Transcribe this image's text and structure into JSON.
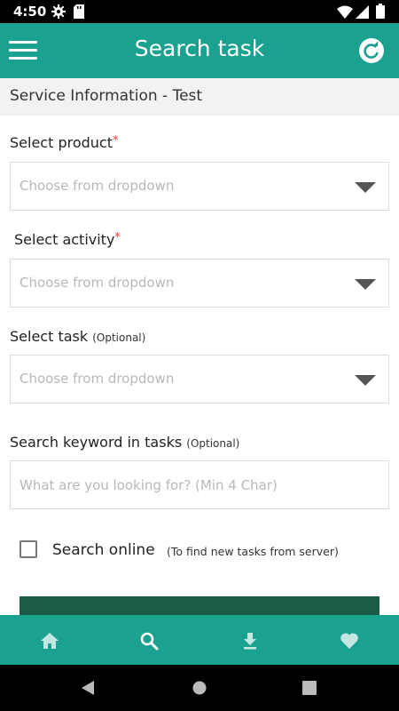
{
  "status_bar": {
    "time": "4:50",
    "icons": [
      "settings-icon",
      "sd-card-icon",
      "wifi-icon",
      "signal-icon",
      "battery-icon"
    ]
  },
  "app_bar": {
    "title": "Search task",
    "menu_icon": "hamburger-menu-icon",
    "refresh_icon": "refresh-icon",
    "color": "#1aa190"
  },
  "section_header": {
    "text": "Service Information - Test"
  },
  "form": {
    "product": {
      "label": "Select product",
      "required_mark": "*",
      "placeholder": "Choose from dropdown"
    },
    "activity": {
      "label": "Select activity",
      "required_mark": "*",
      "placeholder": "Choose from dropdown"
    },
    "task": {
      "label": "Select task",
      "optional_note": "(Optional)",
      "placeholder": "Choose from dropdown"
    },
    "keyword": {
      "label": "Search keyword in tasks",
      "optional_note": "(Optional)",
      "placeholder": "What are you looking for? (Min 4 Char)",
      "value": ""
    },
    "search_online": {
      "label": "Search online",
      "hint": "(To find new tasks from server)",
      "checked": false
    },
    "submit_button_color": "#1a5c47"
  },
  "bottom_nav": {
    "items": [
      {
        "name": "home",
        "icon": "home-icon"
      },
      {
        "name": "search",
        "icon": "search-icon"
      },
      {
        "name": "download",
        "icon": "download-icon"
      },
      {
        "name": "favorites",
        "icon": "heart-icon"
      }
    ],
    "color": "#1aa190"
  },
  "system_nav": {
    "buttons": [
      "back-icon",
      "home-circle-icon",
      "recents-icon"
    ]
  }
}
